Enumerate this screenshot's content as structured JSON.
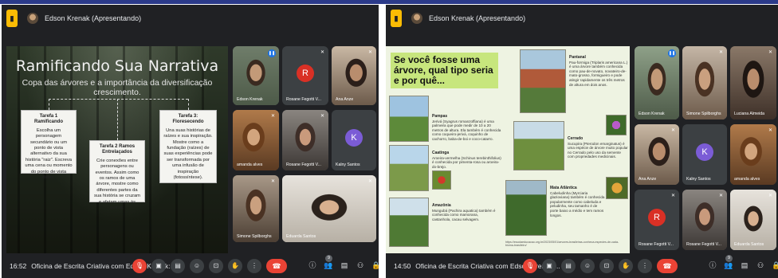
{
  "left": {
    "presenter": "Edson Krenak (Apresentando)",
    "slide": {
      "title": "Ramificando Sua Narrativa",
      "subtitle": "Copa das árvores e a importância da diversificação crescimento.",
      "cards": [
        {
          "title": "Tarefa 1 Ramificando",
          "body": "Escolha um personagem secundário ou um ponto de vista alternativo da sua história \"raiz\". Escreva uma cena ou momento do ponto de vista deles."
        },
        {
          "title": "Tarefa 2 Ramos Entrelaçados",
          "body": "Crie conexões entre personagens ou eventos. Assim como os ramos de uma árvore, mostre como diferentes partes da sua história se cruzam e afetam umas às outras."
        },
        {
          "title": "Tarefa 3: Floresecendo",
          "body": "Una suas histórias de raízes e sua inspiração. Mostre como a fundação (raízes) de suas experiências pode ser transformada por uma infusão de inspiração (fotossíntese)."
        }
      ]
    },
    "participants": [
      {
        "name": "Edson Krenak",
        "status": "speaking"
      },
      {
        "name": "Rosane Fegotti V...",
        "avatar_letter": "R",
        "avatar_color": "#d93025"
      },
      {
        "name": "Ana Anze"
      },
      {
        "name": "amanda alves"
      },
      {
        "name": "Rosane Fegotti V..."
      },
      {
        "name": "Kalny Santos",
        "avatar_letter": "K",
        "avatar_color": "#7b5cd6"
      },
      {
        "name": "Simone Spilborghs"
      },
      {
        "name": "Eduarda Santos"
      }
    ],
    "bottom": {
      "time": "16:52",
      "meeting": "Oficina de Escrita Criativa com Edson Krenak:..."
    }
  },
  "right": {
    "presenter": "Edson Krenak (Apresentando)",
    "slide": {
      "question": "Se você fosse uma árvore, qual tipo seria e por quê...",
      "biomes": [
        {
          "name": "Pampas",
          "text": "Jerivá (Syagrus romanzoffiana) é uma palmeira que pode medir de 10 a 20 metros de altura. Ela também é conhecida como coqueiro-jerivá, coquinho de cachorro, baba-de-boi e coco-catarro."
        },
        {
          "name": "Caatinga",
          "text": "Aroeira-vermelha (Schinus terebinthifolius) é conhecida por pimenta-rosa ou aroeira-do-brejo."
        },
        {
          "name": "Amazônia",
          "text": "Mungubá (Pachira aquatica) também é conhecida como mamorana, castanhola, cacau selvagem."
        },
        {
          "name": "Pantanal",
          "text": "Pau-formiga (Triplaris americana L.) é uma árvore também conhecida como pau-de-novato, novateiro-de-mato-grosso, formigueiro e pode atingir rapidamente os três metros de altura em dois anos."
        },
        {
          "name": "Cerrado",
          "text": "Sucupira (Pterodon emarginatus) é uma espécie de árvore muito popular no Cerrado pelo uso da semente com propriedades medicinais."
        },
        {
          "name": "Mata Atlântica",
          "text": "Cabeludinha (Myrciaria glazioviana) também é conhecida popularmente como cabeluda e peludinha, seu tamanho é de porte baixo a médio e tem ramos longos."
        }
      ],
      "source_link": "https://escolaeducacao.org.br/2023/05/01/arvores-brasileiras-conheca-especies-de-cada-bioma-brasileiro/"
    },
    "participants": [
      {
        "name": "Edson Krenak",
        "status": "speaking"
      },
      {
        "name": "Simone Spilborghs"
      },
      {
        "name": "Luciana Almeida"
      },
      {
        "name": "Ana Anze"
      },
      {
        "name": "Kalny Santos",
        "avatar_letter": "K",
        "avatar_color": "#7b5cd6"
      },
      {
        "name": "amanda alves"
      },
      {
        "name": "Rosane Fegotti V...",
        "avatar_letter": "R",
        "avatar_color": "#d93025"
      },
      {
        "name": "Rosane Fegotti V..."
      },
      {
        "name": "Eduarda Santos"
      }
    ],
    "bottom": {
      "time": "14:50",
      "meeting": "Oficina de Escrita Criativa com Edson Krenak:..."
    }
  },
  "controls": {
    "icons": [
      "mic-off-icon",
      "camera-icon",
      "captions-icon",
      "emoji-icon",
      "present-icon",
      "raise-hand-icon",
      "more-icon",
      "end-call-icon"
    ],
    "right_icons": [
      "info-icon",
      "people-icon",
      "chat-icon",
      "activities-icon",
      "lock-icon"
    ],
    "people_count": "9"
  },
  "colors": {
    "end_call": "#ea4335",
    "meet_bg": "#202124",
    "tile_bg": "#3c4043",
    "speaking": "#1a73e8",
    "top_strip": "#2b3a8a",
    "question_bg": "#c7e67d"
  }
}
